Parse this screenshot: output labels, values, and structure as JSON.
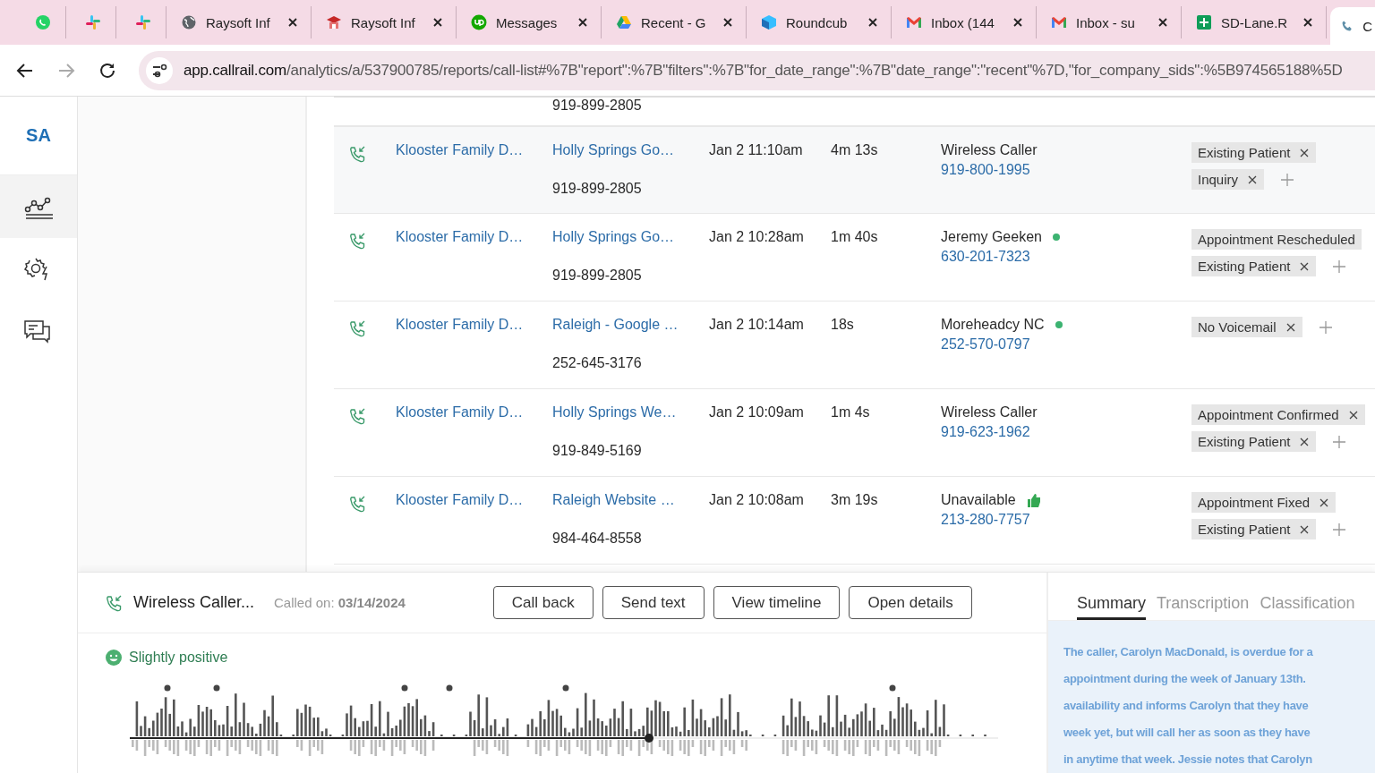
{
  "browser": {
    "tabs": [
      {
        "kind": "whatsapp",
        "selected": false
      },
      {
        "kind": "slack",
        "selected": false
      },
      {
        "kind": "slack",
        "selected": false
      },
      {
        "kind": "globe",
        "title": "Raysoft Inf",
        "selected": false
      },
      {
        "kind": "school",
        "title": "Raysoft Inf",
        "selected": false
      },
      {
        "kind": "upwork",
        "title": "Messages",
        "selected": false
      },
      {
        "kind": "drive",
        "title": "Recent - G",
        "selected": false
      },
      {
        "kind": "cube",
        "title": "Roundcub",
        "selected": false
      },
      {
        "kind": "mail",
        "title": "Inbox (144",
        "selected": false
      },
      {
        "kind": "mail",
        "title": "Inbox - su",
        "selected": false
      },
      {
        "kind": "sheet",
        "title": "SD-Lane.R",
        "selected": false
      },
      {
        "kind": "phone",
        "title": "C",
        "selected": true
      }
    ],
    "address_bar": {
      "url": "app.callrail.com/analytics/a/537900785/reports/call-list#%7B\"report\":%7B\"filters\":%7B\"for_date_range\":%7B\"date_range\":\"recent\"%7D,\"for_company_sids\":%5B974565188%5D"
    }
  },
  "sidebar": {
    "account": "SA",
    "items": [
      {
        "kind": "analytics",
        "selected": true
      },
      {
        "kind": "automation",
        "selected": false
      },
      {
        "kind": "messages",
        "selected": false
      }
    ]
  },
  "calls": {
    "partial_row": {
      "tracking_number": "919-899-2805"
    },
    "rows": [
      {
        "company": "Klooster Family D…",
        "source": "Holly Springs Go…",
        "tracking_number": "919-899-2805",
        "date": "Jan 2 11:10am",
        "duration": "4m 13s",
        "caller": "Wireless Caller",
        "caller_number": "919-800-1995",
        "selected": true,
        "tags": [
          {
            "label": "Existing Patient",
            "removable": true
          },
          {
            "label": "Inquiry",
            "removable": true
          }
        ]
      },
      {
        "company": "Klooster Family D…",
        "source": "Holly Springs Go…",
        "tracking_number": "919-899-2805",
        "date": "Jan 2 10:28am",
        "duration": "1m 40s",
        "caller": "Jeremy Geeken",
        "caller_number": "630-201-7323",
        "indicator": {
          "kind": "dot"
        },
        "selected": false,
        "tags": [
          {
            "label": "Appointment Rescheduled",
            "removable": false
          },
          {
            "label": "Existing Patient",
            "removable": true
          }
        ]
      },
      {
        "company": "Klooster Family D…",
        "source": "Raleigh - Google …",
        "tracking_number": "252-645-3176",
        "date": "Jan 2 10:14am",
        "duration": "18s",
        "caller": "Moreheadcy NC",
        "caller_number": "252-570-0797",
        "indicator": {
          "kind": "dot"
        },
        "selected": false,
        "tags": [
          {
            "label": "No Voicemail",
            "removable": true
          }
        ]
      },
      {
        "company": "Klooster Family D…",
        "source": "Holly Springs We…",
        "tracking_number": "919-849-5169",
        "date": "Jan 2 10:09am",
        "duration": "1m 4s",
        "caller": "Wireless Caller",
        "caller_number": "919-623-1962",
        "selected": false,
        "tags": [
          {
            "label": "Appointment Confirmed",
            "removable": true
          },
          {
            "label": "Existing Patient",
            "removable": true
          }
        ]
      },
      {
        "company": "Klooster Family D…",
        "source": "Raleigh Website …",
        "tracking_number": "984-464-8558",
        "date": "Jan 2 10:08am",
        "duration": "3m 19s",
        "caller": "Unavailable",
        "caller_number": "213-280-7757",
        "indicator": {
          "kind": "thumb"
        },
        "selected": false,
        "tags": [
          {
            "label": "Appointment Fixed",
            "removable": true
          },
          {
            "label": "Existing Patient",
            "removable": true
          }
        ]
      }
    ]
  },
  "call_panel": {
    "caller": "Wireless Caller...",
    "called_on": "Called on: **03/14/2024**",
    "buttons": [
      "Call back",
      "Send text",
      "View timeline",
      "Open details"
    ],
    "sentiment": "Slightly positive",
    "recording": {
      "kind": "picture"
    },
    "tabs": [
      {
        "label": "Summary",
        "selected": true
      },
      {
        "label": "Transcription",
        "selected": false
      },
      {
        "label": "Classification",
        "selected": false
      }
    ],
    "summary_lines": [
      "The caller, Carolyn MacDonald, is overdue for a",
      "appointment during the week of January 13th.",
      "availability and informs Carolyn that they have",
      "week yet, but will call her as soon as they have",
      "in anytime that week. Jessie notes that Carolyn"
    ]
  }
}
